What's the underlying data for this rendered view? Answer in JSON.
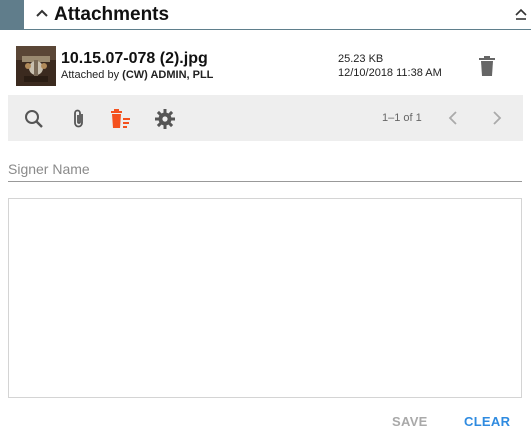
{
  "header": {
    "title": "Attachments"
  },
  "attachment": {
    "file_name": "10.15.07-078 (2).jpg",
    "attached_by_prefix": "Attached by",
    "attached_by_name": "(CW) ADMIN, PLL",
    "size": "25.23 KB",
    "date": "12/10/2018 11:38 AM"
  },
  "toolbar": {
    "icons": [
      "search-icon",
      "paperclip-icon",
      "delete-list-icon",
      "gear-icon"
    ],
    "delete_icon_color": "#f4511e",
    "pagination": "1–1 of 1"
  },
  "signature": {
    "placeholder": "Signer Name",
    "save_label": "SAVE",
    "clear_label": "CLEAR"
  },
  "colors": {
    "accent_strip": "#607d8b",
    "clear_button": "#2f8be0",
    "save_button_disabled": "#a9a9a9"
  }
}
